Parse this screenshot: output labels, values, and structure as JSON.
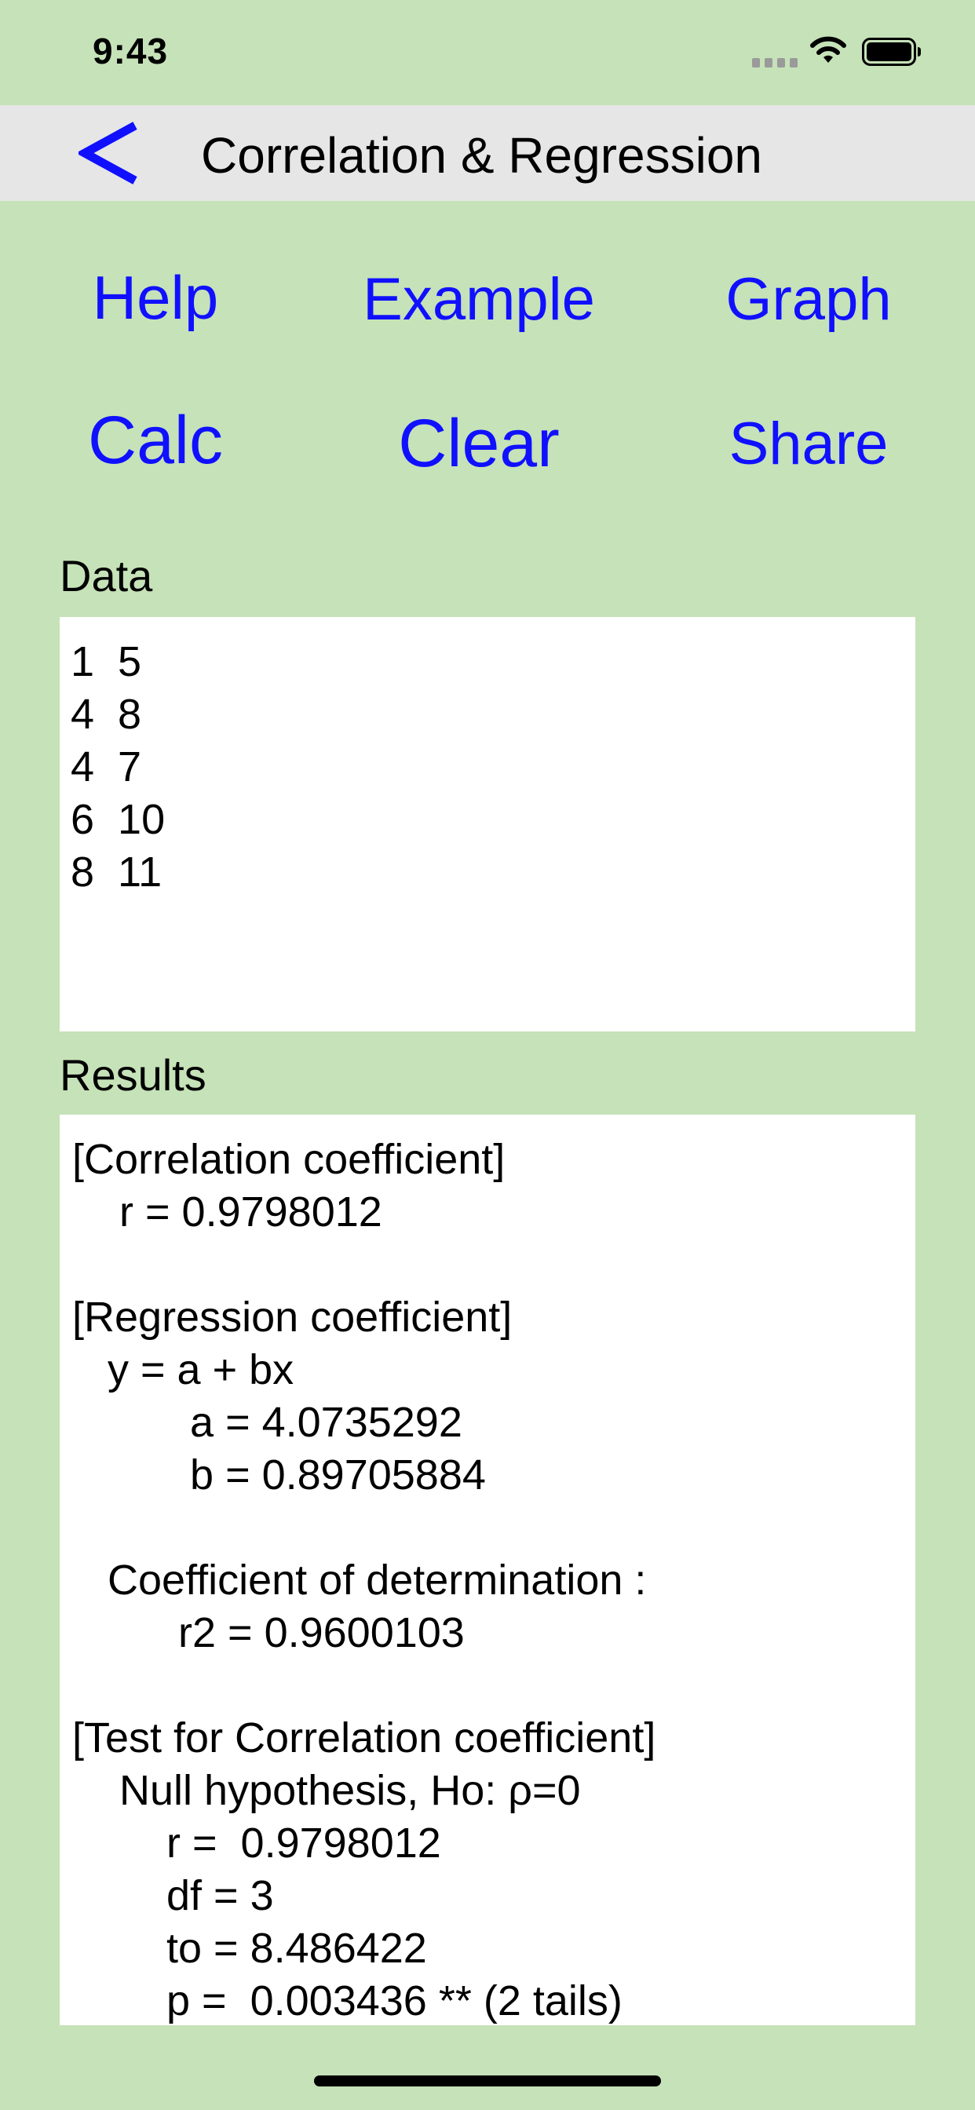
{
  "status_bar": {
    "time": "9:43"
  },
  "nav": {
    "back_glyph": "<",
    "title": "Correlation & Regression"
  },
  "actions": {
    "help": "Help",
    "example": "Example",
    "graph": "Graph",
    "calc": "Calc",
    "clear": "Clear",
    "share": "Share"
  },
  "data_section": {
    "label": "Data",
    "value": "1  5\n4  8\n4  7\n6  10\n8  11"
  },
  "results_section": {
    "label": "Results",
    "value": "[Correlation coefficient]\n    r = 0.9798012\n\n[Regression coefficient]\n   y = a + bx\n          a = 4.0735292\n          b = 0.89705884\n\n   Coefficient of determination :\n         r2 = 0.9600103\n\n[Test for Correlation coefficient]\n    Null hypothesis, Ho: ρ=0\n        r =  0.9798012\n        df = 3\n        to = 8.486422\n        p =  0.003436 ** (2 tails)"
  },
  "colors": {
    "background": "#c6e2b8",
    "nav_background": "#e6e6e6",
    "accent": "#1010ff"
  }
}
